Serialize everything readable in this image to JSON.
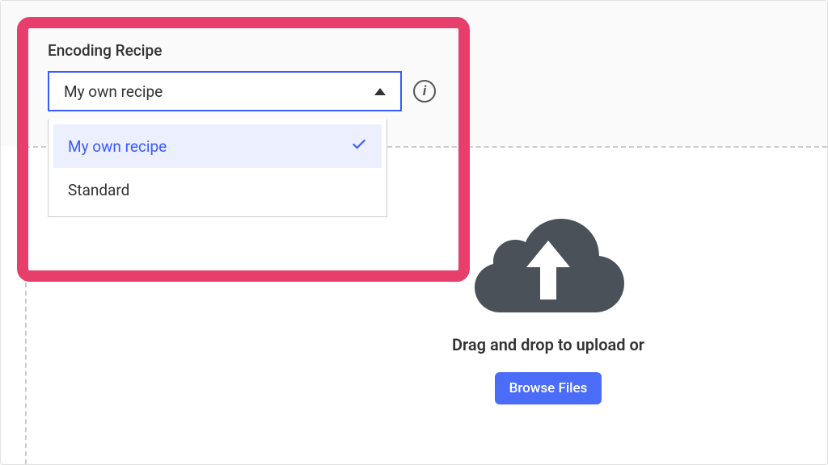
{
  "recipe": {
    "label": "Encoding Recipe",
    "selected": "My own recipe",
    "options": [
      "My own recipe",
      "Standard"
    ],
    "info_symbol": "i"
  },
  "upload": {
    "hint": "Drag and drop to upload or",
    "browse_label": "Browse Files"
  },
  "colors": {
    "highlight": "#e83e6b",
    "primary": "#3b5bfd",
    "primary_btn": "#4a6cf7",
    "cloud": "#4a5158"
  }
}
